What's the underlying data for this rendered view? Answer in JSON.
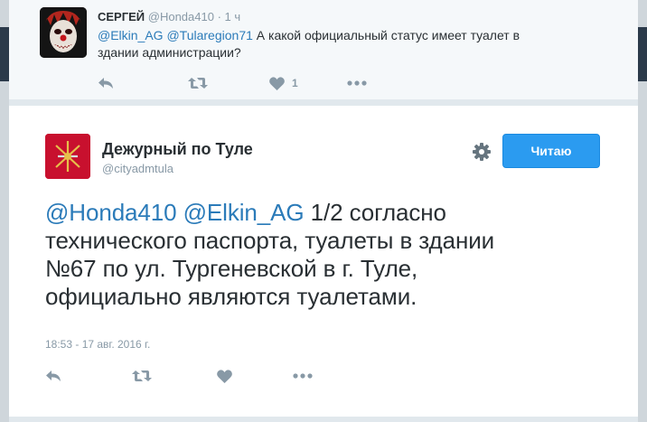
{
  "parent_tweet": {
    "name": "СЕРГЕЙ",
    "handle": "@Honda410",
    "separator": "·",
    "time": "1 ч",
    "mention_1": "@Elkin_AG",
    "mention_2": "@Tularegion71",
    "text": "А какой официальный статус имеет туалет в",
    "text_line2": "здании администрации?",
    "like_count": "1"
  },
  "main_tweet": {
    "name": "Дежурный по Туле",
    "handle": "@cityadmtula",
    "follow_label": "Читаю",
    "mention_1": "@Honda410",
    "mention_2": "@Elkin_AG",
    "line1_rest": "1/2 согласно",
    "line2": "технического паспорта, туалеты в здании",
    "line3": "№67 по ул. Тургеневской в г. Туле,",
    "line4": "официально являются туалетами.",
    "timestamp": "18:53 - 17 авг. 2016 г."
  },
  "icons": {
    "reply": "reply-icon",
    "retweet": "retweet-icon",
    "like": "heart-icon",
    "more": "more-icon",
    "settings": "gear-icon"
  },
  "colors": {
    "link": "#2b7bb9",
    "follow_button": "#2b9bf0",
    "muted": "#8899a6",
    "avatar_red": "#c8102e"
  }
}
